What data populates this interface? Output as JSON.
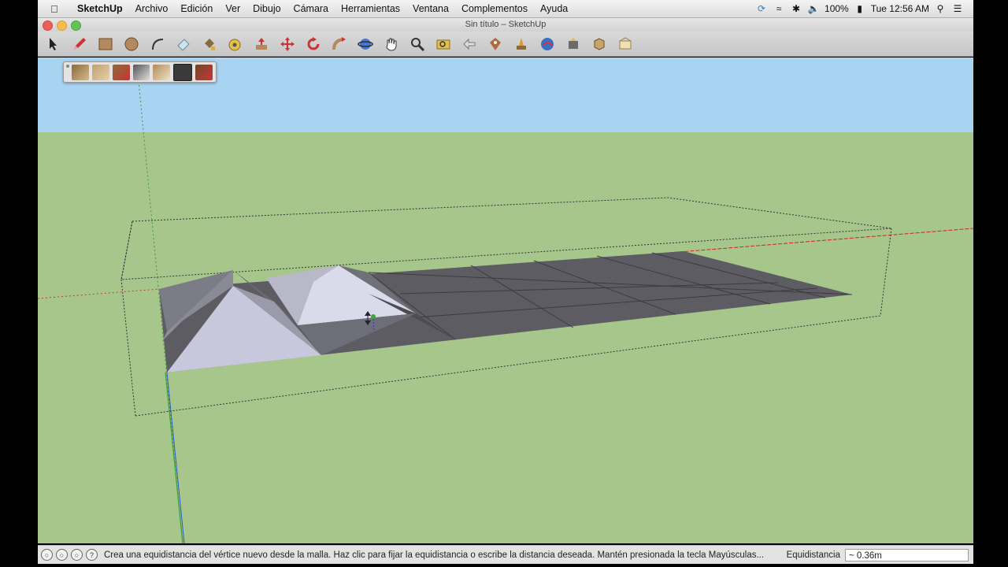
{
  "menubar": {
    "app_name": "SketchUp",
    "items": [
      "Archivo",
      "Edición",
      "Ver",
      "Dibujo",
      "Cámara",
      "Herramientas",
      "Ventana",
      "Complementos",
      "Ayuda"
    ],
    "battery": "100%",
    "clock": "Tue 12:56 AM"
  },
  "window": {
    "title": "Sin título – SketchUp"
  },
  "toolbar": {
    "tools": [
      "select-icon",
      "pencil-icon",
      "rectangle-icon",
      "circle-icon",
      "arc-icon",
      "eraser-icon",
      "paint-bucket-icon",
      "tape-measure-icon",
      "push-pull-icon",
      "move-icon",
      "rotate-icon",
      "follow-me-icon",
      "orbit-icon",
      "pan-icon",
      "zoom-icon",
      "zoom-extents-icon",
      "previous-view-icon",
      "add-location-icon",
      "toggle-terrain-icon",
      "get-models-icon",
      "share-model-icon",
      "components-icon",
      "extension-warehouse-icon",
      "send-to-layout-icon"
    ]
  },
  "sandbox_toolbar": {
    "tools": [
      "from-contours-icon",
      "from-scratch-icon",
      "smoove-icon",
      "stamp-icon",
      "drape-icon",
      "add-detail-icon",
      "flip-edge-icon"
    ]
  },
  "colors": {
    "sky": "#a8d4f2",
    "ground": "#a6c68c",
    "mesh": "#5c5c62",
    "mesh_light": "#c8c8dc"
  },
  "status": {
    "message": "Crea una equidistancia del vértice nuevo desde la malla. Haz clic para fijar la equidistancia o escribe la distancia deseada. Mantén presionada la tecla Mayúsculas...",
    "measure_label": "Equidistancia",
    "measure_value": "~ 0.36m"
  }
}
